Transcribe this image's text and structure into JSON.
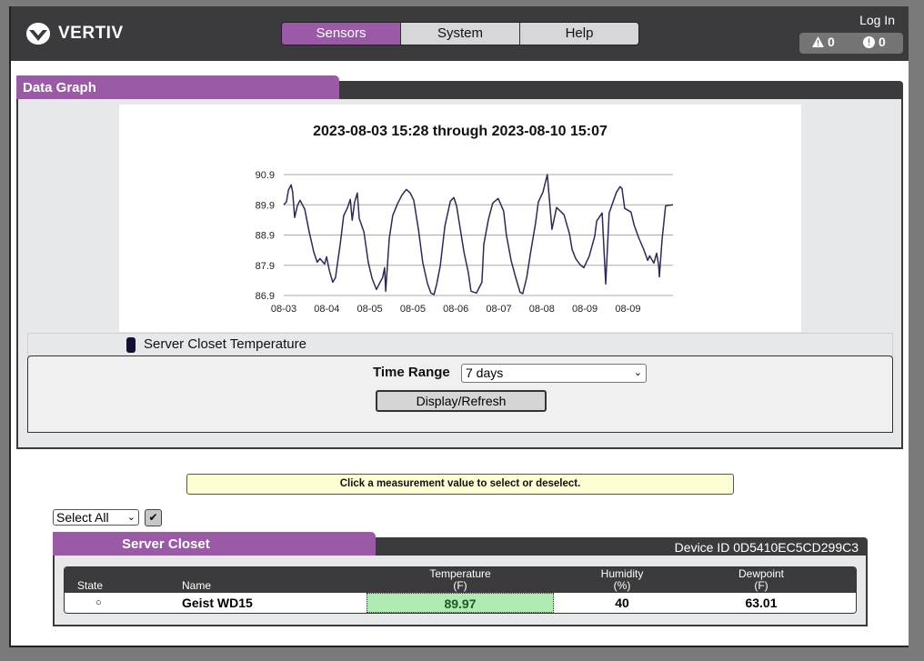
{
  "header": {
    "brand": "VERTIV",
    "nav": [
      {
        "label": "Sensors",
        "active": true
      },
      {
        "label": "System",
        "active": false
      },
      {
        "label": "Help",
        "active": false
      }
    ],
    "login_label": "Log In",
    "alarms": {
      "warning_count": "0",
      "alarm_count": "0"
    }
  },
  "graph_panel": {
    "title": "Data Graph",
    "legend_label": "Server Closet Temperature",
    "time_range_label": "Time Range",
    "time_range_value": "7 days",
    "refresh_label": "Display/Refresh"
  },
  "chart_data": {
    "type": "line",
    "title": "2023-08-03 15:28 through 2023-08-10 15:07",
    "xlabel": "",
    "ylabel": "",
    "x_tick_labels": [
      "08-03",
      "08-04",
      "08-05",
      "08-05",
      "08-06",
      "08-07",
      "08-08",
      "08-09",
      "08-09"
    ],
    "y_ticks": [
      86.9,
      87.9,
      88.9,
      89.9,
      90.9
    ],
    "ylim": [
      86.9,
      90.9
    ],
    "grid": true,
    "legend": "bottom",
    "series": [
      {
        "name": "Server Closet Temperature",
        "color": "#2b2b55",
        "x_fraction": [
          0,
          0.007,
          0.012,
          0.019,
          0.023,
          0.028,
          0.035,
          0.042,
          0.054,
          0.065,
          0.077,
          0.086,
          0.093,
          0.105,
          0.11,
          0.117,
          0.126,
          0.133,
          0.145,
          0.154,
          0.164,
          0.171,
          0.176,
          0.182,
          0.189,
          0.194,
          0.206,
          0.217,
          0.227,
          0.238,
          0.245,
          0.254,
          0.259,
          0.262,
          0.271,
          0.28,
          0.292,
          0.304,
          0.315,
          0.325,
          0.334,
          0.346,
          0.357,
          0.369,
          0.378,
          0.386,
          0.393,
          0.402,
          0.414,
          0.428,
          0.437,
          0.444,
          0.463,
          0.474,
          0.481,
          0.495,
          0.509,
          0.514,
          0.526,
          0.537,
          0.551,
          0.565,
          0.572,
          0.584,
          0.596,
          0.607,
          0.614,
          0.624,
          0.635,
          0.647,
          0.654,
          0.666,
          0.677,
          0.689,
          0.701,
          0.72,
          0.734,
          0.741,
          0.75,
          0.762,
          0.771,
          0.785,
          0.799,
          0.804,
          0.818,
          0.827,
          0.836,
          0.855,
          0.864,
          0.869,
          0.876,
          0.892,
          0.9,
          0.911,
          0.924,
          0.935,
          0.94,
          0.951,
          0.958,
          0.963,
          0.965,
          0.972,
          0.981,
          1.0
        ],
        "values": [
          89.9,
          90.0,
          90.38,
          90.56,
          90.32,
          89.48,
          89.87,
          90.05,
          89.75,
          89.03,
          88.34,
          88.0,
          88.12,
          87.94,
          88.18,
          87.73,
          87.34,
          87.49,
          88.6,
          89.54,
          89.81,
          90.08,
          89.39,
          89.99,
          90.29,
          89.45,
          89.0,
          88.0,
          87.46,
          87.1,
          87.28,
          87.49,
          87.82,
          87.04,
          88.78,
          89.54,
          89.93,
          90.23,
          90.41,
          90.29,
          90.05,
          89.09,
          88.0,
          87.31,
          86.98,
          86.93,
          87.28,
          87.88,
          89.2,
          90.02,
          90.14,
          89.87,
          88.33,
          87.67,
          87.04,
          86.98,
          87.34,
          88.6,
          89.42,
          89.96,
          90.11,
          89.69,
          88.9,
          88.06,
          87.49,
          87.01,
          86.96,
          87.49,
          88.39,
          89.3,
          89.99,
          90.32,
          90.9,
          89.09,
          89.81,
          89.57,
          88.94,
          88.42,
          88.12,
          87.91,
          87.82,
          88.21,
          88.87,
          89.36,
          89.63,
          87.28,
          89.63,
          90.32,
          90.5,
          90.44,
          89.78,
          89.66,
          89.24,
          88.84,
          88.45,
          88.06,
          88.21,
          87.97,
          88.3,
          87.91,
          87.52,
          88.75,
          89.87,
          89.9
        ]
      }
    ]
  },
  "info_bar": "Click a measurement value to select or deselect.",
  "select_all": {
    "value": "Select All"
  },
  "sensor_panel": {
    "title": "Server Closet",
    "device_id": "Device ID 0D5410EC5CD299C3",
    "columns": [
      {
        "label": "State",
        "unit": ""
      },
      {
        "label": "Name",
        "unit": ""
      },
      {
        "label": "Temperature",
        "unit": "(F)"
      },
      {
        "label": "Humidity",
        "unit": "(%)"
      },
      {
        "label": "Dewpoint",
        "unit": "(F)"
      }
    ],
    "rows": [
      {
        "state": "○",
        "name": "Geist WD15",
        "temperature": "89.97",
        "humidity": "40",
        "dewpoint": "63.01",
        "temperature_selected": true
      }
    ],
    "selected_color": "#aeeab2"
  }
}
